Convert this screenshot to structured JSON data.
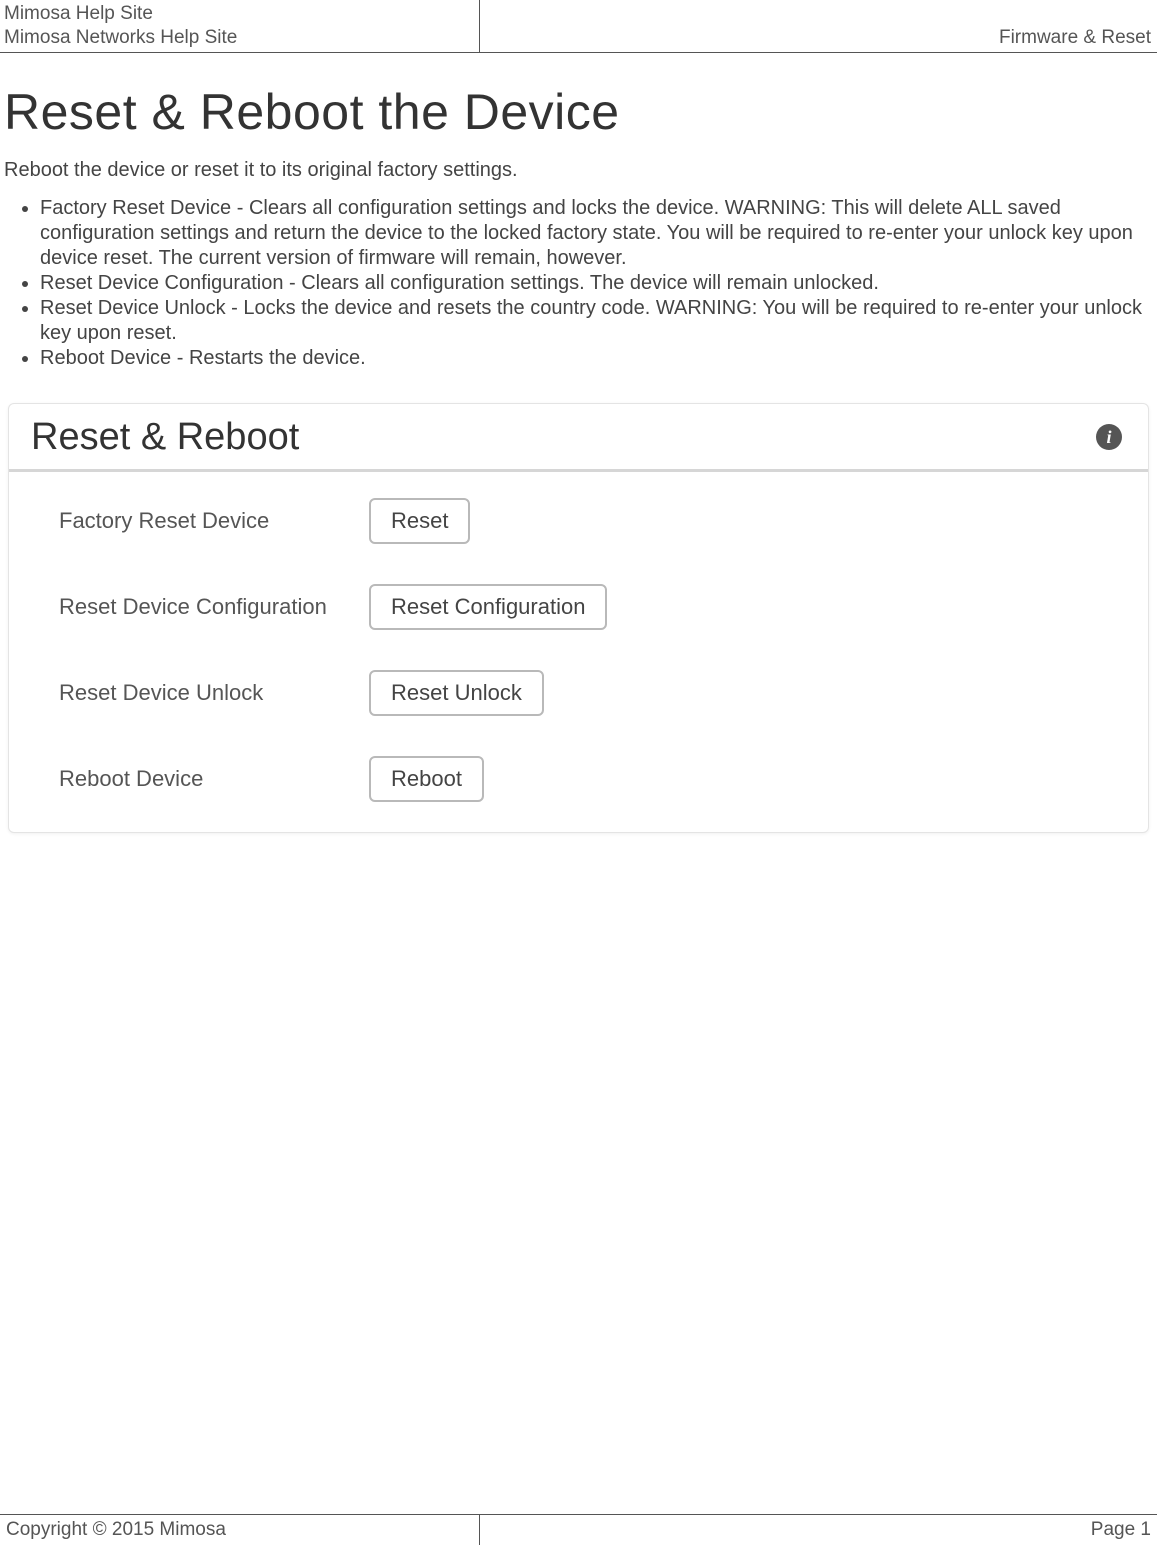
{
  "header": {
    "site_line1": "Mimosa Help Site",
    "site_line2": "Mimosa Networks Help Site",
    "section": "Firmware & Reset"
  },
  "footer": {
    "copyright": "Copyright © 2015 Mimosa",
    "page": "Page 1"
  },
  "title": "Reset & Reboot the Device",
  "intro": "Reboot the device or reset it to its original factory settings.",
  "bullets": [
    "Factory Reset Device - Clears all configuration settings and locks the device. WARNING: This will delete ALL saved configuration settings and return the device to the locked factory state. You will be required to re-enter your unlock key upon device reset. The current version of firmware will remain, however.",
    "Reset Device Configuration - Clears all configuration settings. The device will remain unlocked.",
    "Reset Device Unlock - Locks the device and resets the country code. WARNING: You will be required to re-enter your unlock key upon reset.",
    "Reboot Device - Restarts the device."
  ],
  "panel": {
    "title": "Reset & Reboot",
    "rows": [
      {
        "label": "Factory Reset Device",
        "button": "Reset"
      },
      {
        "label": "Reset Device Configuration",
        "button": "Reset Configuration"
      },
      {
        "label": "Reset Device Unlock",
        "button": "Reset Unlock"
      },
      {
        "label": "Reboot Device",
        "button": "Reboot"
      }
    ]
  }
}
